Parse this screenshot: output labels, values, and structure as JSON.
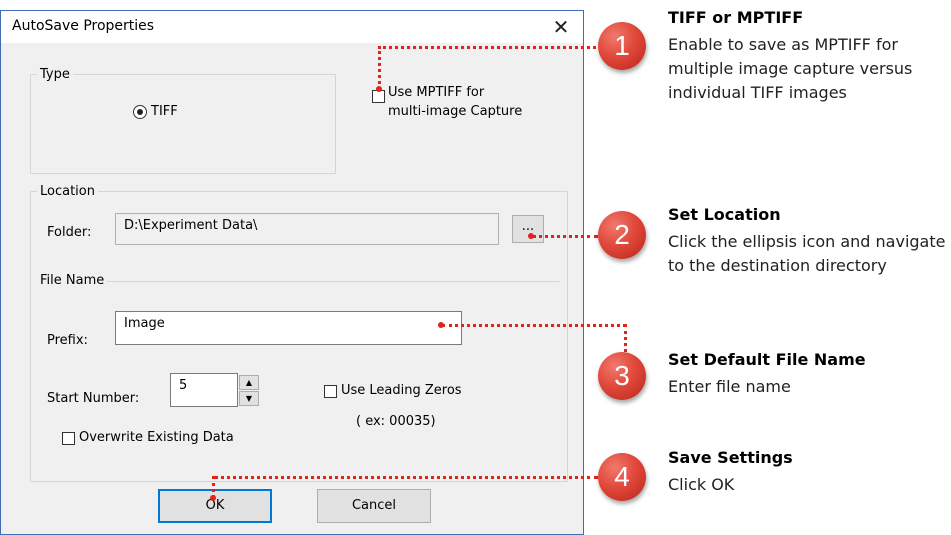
{
  "dialog": {
    "title": "AutoSave Properties",
    "close_glyph": "✕",
    "type_group": {
      "legend": "Type",
      "radio_label": "TIFF",
      "mptiff_line1": "Use MPTIFF for",
      "mptiff_line2": "multi-image Capture"
    },
    "location_group": {
      "legend": "Location",
      "folder_label": "Folder:",
      "folder_value": "D:\\Experiment Data\\",
      "browse_label": "..."
    },
    "filename_group": {
      "legend": "File Name",
      "prefix_label": "Prefix:",
      "prefix_value": "Image",
      "start_label": "Start Number:",
      "start_value": "5",
      "leading_zeros_label": "Use Leading Zeros",
      "leading_zeros_example": "( ex: 00035)",
      "overwrite_label": "Overwrite Existing Data"
    },
    "ok_label": "OK",
    "cancel_label": "Cancel"
  },
  "annotations": [
    {
      "number": "1",
      "title": "TIFF or MPTIFF",
      "body": "Enable to save as MPTIFF for multiple image capture versus individual TIFF images"
    },
    {
      "number": "2",
      "title": "Set Location",
      "body": "Click the ellipsis icon and navigate to the destination directory"
    },
    {
      "number": "3",
      "title": "Set Default File Name",
      "body": "Enter file name"
    },
    {
      "number": "4",
      "title": "Save Settings",
      "body": "Click OK"
    }
  ],
  "colors": {
    "callout": "#e0483a",
    "dotted_line": "#e2231a",
    "focus": "#0078d7"
  }
}
